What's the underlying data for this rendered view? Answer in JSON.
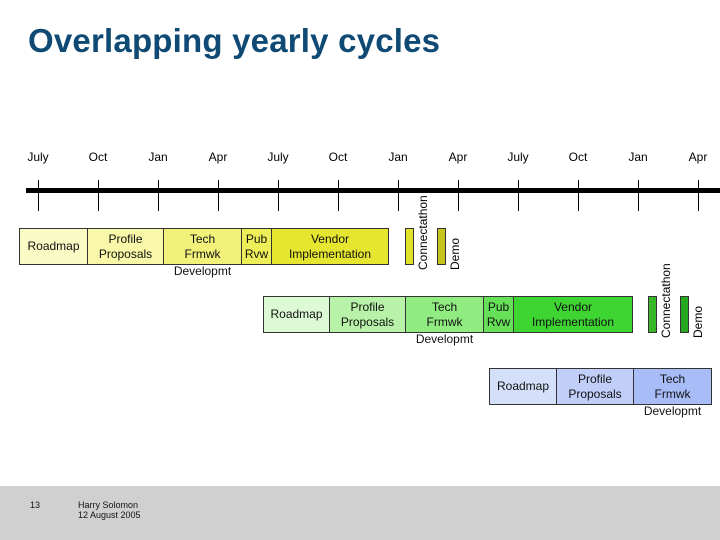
{
  "title": "Overlapping yearly cycles",
  "months": [
    "July",
    "Oct",
    "Jan",
    "Apr",
    "July",
    "Oct",
    "Jan",
    "Apr",
    "July",
    "Oct",
    "Jan",
    "Apr"
  ],
  "cycles": [
    {
      "phases": [
        "Roadmap",
        "Profile\nProposals",
        "Tech\nFrmwk",
        "Pub\nRvw",
        "Vendor\nImplementation"
      ],
      "tech_sub": "Developmt",
      "events": [
        "Connectathon",
        "Demo"
      ],
      "colors": [
        "#fafac4",
        "#f8f8a8",
        "#f2f27a",
        "#eeee58",
        "#e6e630",
        "#e2e228",
        "#c4c41c"
      ]
    },
    {
      "phases": [
        "Roadmap",
        "Profile\nProposals",
        "Tech\nFrmwk",
        "Pub\nRvw",
        "Vendor\nImplementation"
      ],
      "tech_sub": "Developmt",
      "events": [
        "Connectathon",
        "Demo"
      ],
      "colors": [
        "#dcfad4",
        "#b8f2a8",
        "#90ec80",
        "#66e058",
        "#3ed432",
        "#38b828",
        "#28a820"
      ]
    },
    {
      "phases": [
        "Roadmap",
        "Profile\nProposals",
        "Tech\nFrmwk"
      ],
      "tech_sub": "Developmt",
      "colors": [
        "#d4e0fa",
        "#c0cef8",
        "#a8bcf8"
      ]
    }
  ],
  "footer": {
    "page": "13",
    "author": "Harry Solomon",
    "date": "12 August 2005"
  }
}
